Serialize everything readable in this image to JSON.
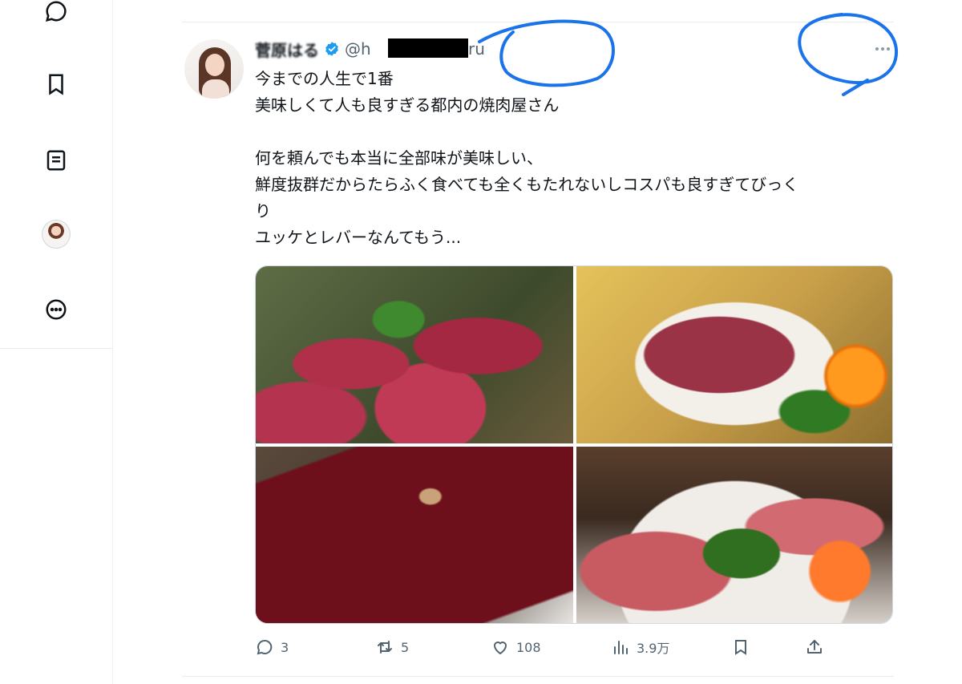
{
  "sidebar": {
    "icons": [
      "messages-icon",
      "bookmarks-icon",
      "lists-icon",
      "profile-avatar",
      "more-options-icon"
    ]
  },
  "tweet": {
    "display_name": "菅原はる",
    "handle": "@h",
    "handle_suffix": "ru",
    "text_lines": [
      "今までの人生で1番",
      "美味しくて人も良すぎる都内の焼肉屋さん",
      "",
      "何を頼んでも本当に全部味が美味しい、",
      "鮮度抜群だからたらふく食べても全くもたれないしコスパも良すぎてびっく",
      "り",
      "ユッケとレバーなんてもう..."
    ],
    "stats": {
      "replies": "3",
      "retweets": "5",
      "likes": "108",
      "views": "3.9万"
    }
  },
  "colors": {
    "text_primary": "#0f1419",
    "text_secondary": "#536471",
    "verified_blue": "#1d9bf0",
    "annotation_blue": "#1a73e8"
  }
}
